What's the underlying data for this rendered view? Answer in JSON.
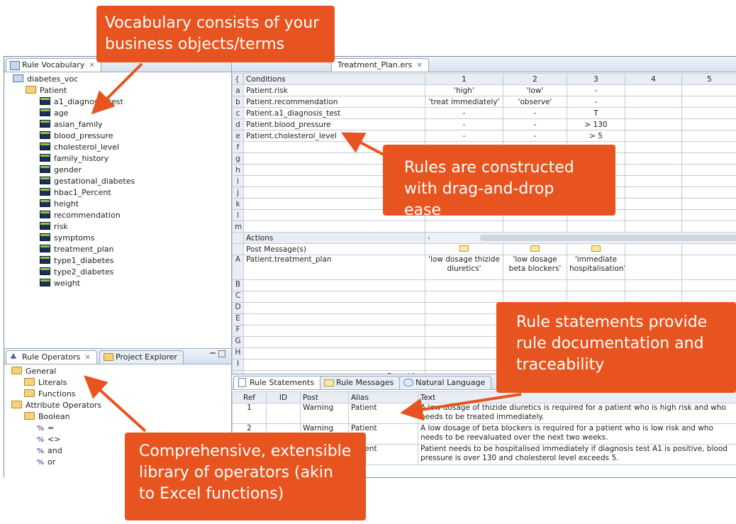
{
  "vocab_panel": {
    "tab_label": "Rule Vocabulary",
    "root": "diabetes_voc",
    "class_node": "Patient",
    "attributes": [
      "a1_diagnosis_test",
      "age",
      "asian_family",
      "blood_pressure",
      "cholesterol_level",
      "family_history",
      "gender",
      "gestational_diabetes",
      "hbac1_Percent",
      "height",
      "recommendation",
      "risk",
      "symptoms",
      "treatment_plan",
      "type1_diabetes",
      "type2_diabetes",
      "weight"
    ]
  },
  "operators_panel": {
    "tab_label": "Rule Operators",
    "tab2_label": "Project Explorer",
    "tree": [
      {
        "label": "General",
        "level": 0,
        "type": "folder"
      },
      {
        "label": "Literals",
        "level": 1,
        "type": "folder"
      },
      {
        "label": "Functions",
        "level": 1,
        "type": "folder"
      },
      {
        "label": "Attribute Operators",
        "level": 0,
        "type": "folder"
      },
      {
        "label": "Boolean",
        "level": 1,
        "type": "folder"
      },
      {
        "label": "=",
        "level": 2,
        "type": "op"
      },
      {
        "label": "<>",
        "level": 2,
        "type": "op"
      },
      {
        "label": "and",
        "level": 2,
        "type": "op"
      },
      {
        "label": "or",
        "level": 2,
        "type": "op"
      }
    ]
  },
  "editor": {
    "tab_label": "Treatment_Plan.ers",
    "conditions_header": "Conditions",
    "columns": [
      "1",
      "2",
      "3",
      "4",
      "5"
    ],
    "conditions": [
      {
        "id": "a",
        "name": "Patient.risk",
        "vals": [
          "'high'",
          "'low'",
          "-"
        ]
      },
      {
        "id": "b",
        "name": "Patient.recommendation",
        "vals": [
          "'treat immediately'",
          "'observe'",
          "-"
        ]
      },
      {
        "id": "c",
        "name": "Patient.a1_diagnosis_test",
        "vals": [
          "-",
          "-",
          "T"
        ]
      },
      {
        "id": "d",
        "name": "Patient.blood_pressure",
        "vals": [
          "-",
          "-",
          "> 130"
        ]
      },
      {
        "id": "e",
        "name": "Patient.cholesterol_level",
        "vals": [
          "-",
          "-",
          "> 5"
        ]
      },
      {
        "id": "f",
        "name": "",
        "vals": [
          "",
          "",
          ""
        ]
      },
      {
        "id": "g",
        "name": "",
        "vals": [
          "",
          "",
          ""
        ]
      },
      {
        "id": "h",
        "name": "",
        "vals": [
          "",
          "",
          ""
        ]
      },
      {
        "id": "i",
        "name": "",
        "vals": [
          "",
          "",
          ""
        ]
      },
      {
        "id": "j",
        "name": "",
        "vals": [
          "",
          "",
          ""
        ]
      },
      {
        "id": "k",
        "name": "",
        "vals": [
          "",
          "",
          ""
        ]
      },
      {
        "id": "l",
        "name": "",
        "vals": [
          "",
          "",
          ""
        ]
      },
      {
        "id": "m",
        "name": "",
        "vals": [
          "",
          "",
          ""
        ]
      }
    ],
    "actions_header": "Actions",
    "post_message": "Post Message(s)",
    "action_rows": [
      {
        "id": "A",
        "name": "Patient.treatment_plan",
        "vals": [
          "'low dosage thizide diuretics'",
          "'low dosage beta blockers'",
          "'immediate hospitalisation'"
        ]
      },
      {
        "id": "B",
        "name": "",
        "vals": [
          "",
          "",
          ""
        ]
      },
      {
        "id": "C",
        "name": "",
        "vals": [
          "",
          "",
          ""
        ]
      },
      {
        "id": "D",
        "name": "",
        "vals": [
          "",
          "",
          ""
        ]
      },
      {
        "id": "E",
        "name": "",
        "vals": [
          "",
          "",
          ""
        ]
      },
      {
        "id": "F",
        "name": "",
        "vals": [
          "",
          "",
          ""
        ]
      },
      {
        "id": "G",
        "name": "",
        "vals": [
          "",
          "",
          ""
        ]
      },
      {
        "id": "H",
        "name": "",
        "vals": [
          "",
          "",
          ""
        ]
      },
      {
        "id": "I",
        "name": "",
        "vals": [
          "",
          "",
          ""
        ]
      }
    ],
    "overrides": "Overrides"
  },
  "statements": {
    "tabs": [
      "Rule Statements",
      "Rule Messages",
      "Natural Language"
    ],
    "headers": [
      "Ref",
      "ID",
      "Post",
      "Alias",
      "Text"
    ],
    "rows": [
      {
        "ref": "1",
        "id": "",
        "post": "Warning",
        "alias": "Patient",
        "text": "A low dosage of thizide diuretics is required for a patient who is high risk and who needs to be treated immediately."
      },
      {
        "ref": "2",
        "id": "",
        "post": "Warning",
        "alias": "Patient",
        "text": "A low dosage of beta blockers is required for a patient who is low risk and who needs to be reevaluated over the next two weeks."
      },
      {
        "ref": "3",
        "id": "",
        "post": "",
        "alias": "Patient",
        "text": "Patient needs to be hospitalised immediately if diagnosis test A1 is positive, blood pressure is over 130 and cholesterol level exceeds 5."
      }
    ]
  },
  "callouts": {
    "vocab": "Vocabulary consists of your business objects/terms",
    "rules": "Rules are constructed with drag-and-drop ease",
    "statements": "Rule statements provide rule documentation and traceability",
    "operators": "Comprehensive, extensible library of operators (akin to Excel functions)"
  },
  "colors": {
    "callout": "#e8541f",
    "tab_bg": "#d6e1ef"
  }
}
